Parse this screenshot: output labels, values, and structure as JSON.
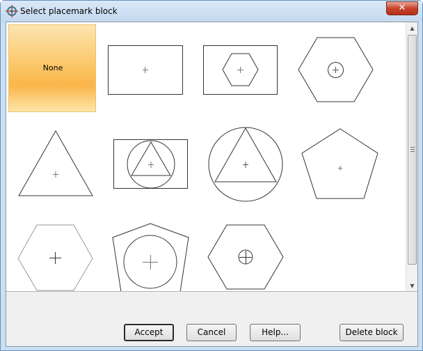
{
  "window": {
    "title": "Select placemark block",
    "close_label": "✕"
  },
  "blocks": {
    "selected_label": "None",
    "items": [
      {
        "name": "None",
        "selected": true
      },
      {
        "name": "rectangle-cross"
      },
      {
        "name": "rectangle-hexagon-cross"
      },
      {
        "name": "hexagon-circle-cross"
      },
      {
        "name": "triangle-cross"
      },
      {
        "name": "rectangle-circle-triangle-cross"
      },
      {
        "name": "circle-triangle-cross"
      },
      {
        "name": "pentagon-cross"
      },
      {
        "name": "hexagon-large-cross"
      },
      {
        "name": "pentagon-circle-cross"
      },
      {
        "name": "hexagon-circle-crosshair"
      }
    ]
  },
  "buttons": {
    "accept": "Accept",
    "cancel": "Cancel",
    "help": "Help...",
    "delete": "Delete block"
  }
}
